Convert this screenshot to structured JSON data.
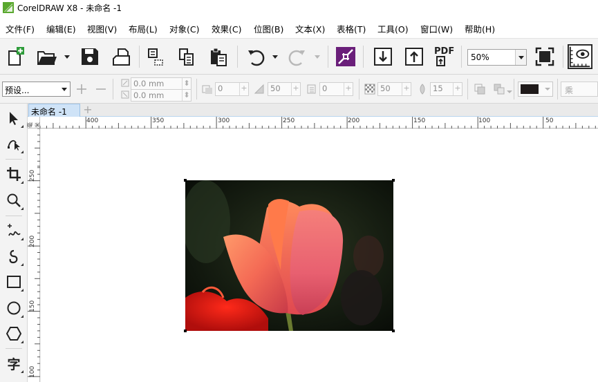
{
  "window": {
    "title": "CorelDRAW X8 - 未命名 -1"
  },
  "menu": [
    "文件(F)",
    "编辑(E)",
    "视图(V)",
    "布局(L)",
    "对象(C)",
    "效果(C)",
    "位图(B)",
    "文本(X)",
    "表格(T)",
    "工具(O)",
    "窗口(W)",
    "帮助(H)"
  ],
  "toolbar": {
    "icons": [
      "new-document-icon",
      "open-folder-icon",
      "save-icon",
      "print-icon",
      "import-icon",
      "copy-icon",
      "paste-icon",
      "undo-icon",
      "redo-icon",
      "corel-connect-icon",
      "import-arrow-icon",
      "export-arrow-icon",
      "export-pdf-icon",
      "full-screen-icon",
      "options-icon"
    ],
    "pdf_label": "PDF",
    "zoom": "50%"
  },
  "property_bar": {
    "preset": "预设...",
    "x_value": "0.0 mm",
    "y_value": "0.0 mm",
    "value1": "0",
    "value2": "50",
    "value3": "0",
    "transparency": "50",
    "feather": "15",
    "mode": "乘",
    "color": "#1f1a1a"
  },
  "toolbox": [
    "pick-tool-icon",
    "shape-tool-icon",
    "crop-tool-icon",
    "zoom-tool-icon",
    "freehand-tool-icon",
    "artistic-media-tool-icon",
    "rectangle-tool-icon",
    "ellipse-tool-icon",
    "polygon-tool-icon",
    "text-tool-icon"
  ],
  "text_tool_label": "字",
  "document": {
    "tab_label": "未命名 -1",
    "new_tab": "+"
  },
  "ruler": {
    "unit": "毫米",
    "h_labels": [
      "400",
      "350",
      "300",
      "250",
      "200",
      "150",
      "100",
      "50"
    ],
    "v_labels": [
      "250",
      "200",
      "150",
      "100"
    ]
  },
  "colors": {
    "accent_tab": "#cfe3f7",
    "toolbar_bg": "#f3f3f3"
  }
}
